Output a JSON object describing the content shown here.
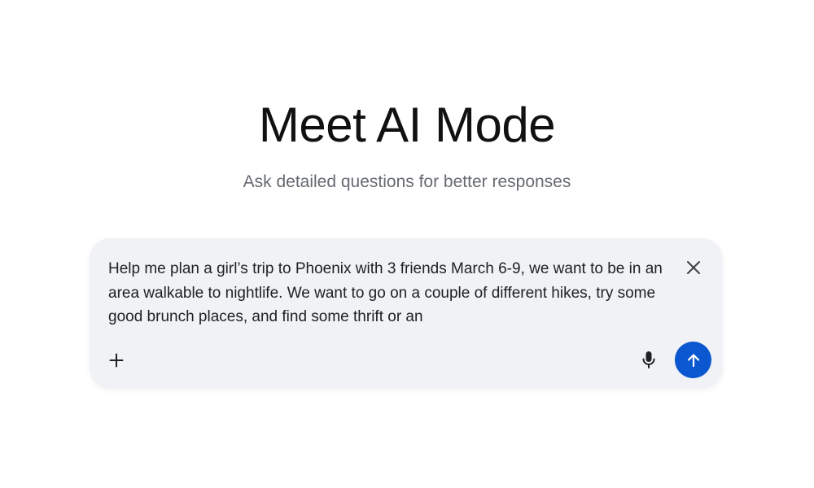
{
  "hero": {
    "title": "Meet AI Mode",
    "subtitle": "Ask detailed questions for better responses"
  },
  "composer": {
    "query": "Help me plan a girl’s trip to Phoenix with 3 friends March 6-9, we want to be in an area walkable to nightlife. We want to go on a couple of different hikes, try some good brunch places, and find some thrift or an",
    "icons": {
      "clear": "close-icon",
      "add": "plus-icon",
      "voice": "microphone-icon",
      "submit": "arrow-up-icon"
    },
    "colors": {
      "background": "#f0f2f6",
      "submit": "#0b57d0"
    }
  }
}
